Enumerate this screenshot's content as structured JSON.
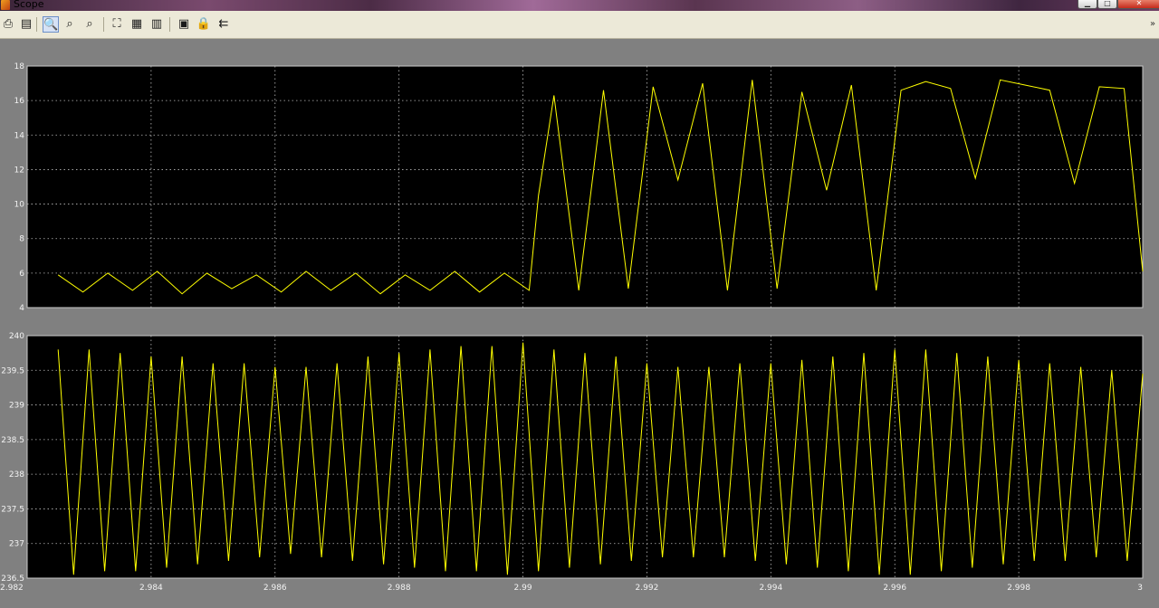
{
  "window": {
    "title": "Scope",
    "controls": {
      "minimize": "▁",
      "maximize": "□",
      "close": "✕"
    }
  },
  "toolbar": {
    "buttons": [
      {
        "name": "print-icon",
        "glyph": "⎙"
      },
      {
        "name": "parameters-icon",
        "glyph": "▤"
      },
      {
        "name": "zoom-icon",
        "glyph": "🔍",
        "active": true
      },
      {
        "name": "zoom-x-icon",
        "glyph": "⌕"
      },
      {
        "name": "zoom-y-icon",
        "glyph": "⌕"
      },
      {
        "name": "autoscale-icon",
        "glyph": "⛶"
      },
      {
        "name": "save-axes-icon",
        "glyph": "▦"
      },
      {
        "name": "restore-axes-icon",
        "glyph": "▥"
      },
      {
        "name": "floating-scope-icon",
        "glyph": "▣"
      },
      {
        "name": "lock-axes-icon",
        "glyph": "🔒"
      },
      {
        "name": "signal-selector-icon",
        "glyph": "⇇"
      }
    ],
    "chevron": "»"
  },
  "colors": {
    "background": "#808080",
    "plot_bg": "#000000",
    "trace": "#ffff00",
    "grid": "#bdbdbd"
  },
  "chart_data": [
    {
      "type": "line",
      "title": "",
      "xlabel": "",
      "ylabel": "",
      "xlim": [
        2.982,
        3.0
      ],
      "ylim": [
        4,
        18
      ],
      "ytick_labels": [
        "4",
        "6",
        "8",
        "10",
        "12",
        "14",
        "16",
        "18"
      ],
      "grid": true,
      "waveform": "square pulses between about 4.8 and 6.1, with narrow spikes to about 16–17 after t = 2.990",
      "series": [
        {
          "x": [
            2.9825,
            2.9829,
            2.9833,
            2.9837,
            2.9841,
            2.9845,
            2.9849,
            2.9853,
            2.9857,
            2.9861,
            2.9865,
            2.9869,
            2.9873,
            2.9877,
            2.9881,
            2.9885,
            2.9889,
            2.9893,
            2.9897,
            2.9901,
            2.99025,
            2.9905,
            2.9909,
            2.9913,
            2.9917,
            2.9921,
            2.9925,
            2.9929,
            2.9933,
            2.9937,
            2.9941,
            2.9945,
            2.9949,
            2.9953,
            2.9957,
            2.9961,
            2.9965,
            2.9969,
            2.9973,
            2.9977,
            2.9981,
            2.9985,
            2.9989,
            2.9993,
            2.9997,
            3.0
          ],
          "y": [
            5.9,
            4.9,
            6.0,
            5.0,
            6.1,
            4.8,
            6.0,
            5.1,
            5.9,
            4.9,
            6.1,
            5.0,
            6.0,
            4.8,
            5.9,
            5.0,
            6.1,
            4.9,
            6.0,
            5.0,
            10.5,
            16.3,
            5.0,
            16.6,
            5.1,
            16.8,
            11.4,
            17.0,
            5.0,
            17.2,
            5.1,
            16.5,
            10.8,
            16.9,
            5.0,
            16.6,
            17.1,
            16.7,
            11.5,
            17.2,
            16.9,
            16.6,
            11.2,
            16.8,
            16.7,
            6.1
          ]
        }
      ]
    },
    {
      "type": "line",
      "title": "",
      "xlabel": "",
      "ylabel": "",
      "xlim": [
        2.982,
        3.0
      ],
      "ylim": [
        236.5,
        240
      ],
      "xtick_labels": [
        "2.982",
        "2.984",
        "2.986",
        "2.988",
        "2.99",
        "2.992",
        "2.994",
        "2.996",
        "2.998",
        "3"
      ],
      "ytick_labels": [
        "236.5",
        "237",
        "237.5",
        "238",
        "238.5",
        "239",
        "239.5",
        "240"
      ],
      "grid": true,
      "waveform": "triangle wave, period about 0.0005",
      "series": [
        {
          "x": [
            2.9825,
            2.98275,
            2.983,
            2.98325,
            2.9835,
            2.98375,
            2.984,
            2.98425,
            2.9845,
            2.98475,
            2.985,
            2.98525,
            2.9855,
            2.98575,
            2.986,
            2.98625,
            2.9865,
            2.98675,
            2.987,
            2.98725,
            2.9875,
            2.98775,
            2.988,
            2.98825,
            2.9885,
            2.98875,
            2.989,
            2.98925,
            2.9895,
            2.98975,
            2.99,
            2.99025,
            2.9905,
            2.99075,
            2.991,
            2.99125,
            2.9915,
            2.99175,
            2.992,
            2.99225,
            2.9925,
            2.99275,
            2.993,
            2.99325,
            2.9935,
            2.99375,
            2.994,
            2.99425,
            2.9945,
            2.99475,
            2.995,
            2.99525,
            2.9955,
            2.99575,
            2.996,
            2.99625,
            2.9965,
            2.99675,
            2.997,
            2.99725,
            2.9975,
            2.99775,
            2.998,
            2.99825,
            2.9985,
            2.99875,
            2.999,
            2.99925,
            2.9995,
            2.99975,
            3.0
          ],
          "y": [
            239.8,
            236.55,
            239.8,
            236.6,
            239.75,
            236.6,
            239.7,
            236.65,
            239.7,
            236.7,
            239.6,
            236.75,
            239.6,
            236.8,
            239.55,
            236.85,
            239.55,
            236.8,
            239.6,
            236.75,
            239.7,
            236.7,
            239.75,
            236.65,
            239.8,
            236.6,
            239.85,
            236.6,
            239.85,
            236.55,
            239.9,
            236.6,
            239.8,
            236.65,
            239.75,
            236.7,
            239.7,
            236.75,
            239.6,
            236.8,
            239.55,
            236.8,
            239.55,
            236.8,
            239.6,
            236.75,
            239.6,
            236.7,
            239.65,
            236.65,
            239.7,
            236.6,
            239.75,
            236.55,
            239.8,
            236.55,
            239.8,
            236.6,
            239.75,
            236.65,
            239.7,
            236.7,
            239.65,
            236.75,
            239.6,
            236.75,
            239.55,
            236.8,
            239.5,
            236.75,
            239.45
          ]
        }
      ]
    }
  ]
}
